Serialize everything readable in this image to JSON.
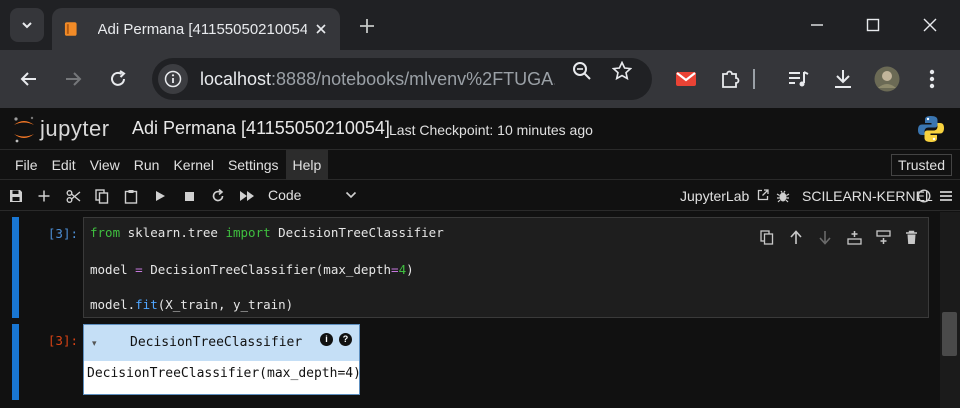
{
  "browser": {
    "tab_title": "Adi Permana [41155050210054]",
    "url_host": "localhost",
    "url_rest": ":8888/notebooks/mlvenv%2FTUGA..."
  },
  "jupyter": {
    "logo_text": "jupyter",
    "notebook_title": "Adi Permana [41155050210054]",
    "checkpoint": "Last Checkpoint: 10 minutes ago"
  },
  "menu": {
    "items": [
      "File",
      "Edit",
      "View",
      "Run",
      "Kernel",
      "Settings",
      "Help"
    ],
    "trusted": "Trusted"
  },
  "toolbar": {
    "cell_type": "Code",
    "jupyterlab_link": "JupyterLab",
    "kernel_name": "SCILEARN-KERNEL"
  },
  "cells": {
    "input_prompt": "[3]:",
    "output_prompt": "[3]:",
    "code": {
      "line1": {
        "kw1": "from",
        "mod": " sklearn.tree ",
        "kw2": "import",
        "name": " DecisionTreeClassifier"
      },
      "line2": {
        "pre": "model ",
        "eq": "=",
        "call": " DecisionTreeClassifier(max_depth",
        "eq2": "=",
        "num": "4",
        "close": ")"
      },
      "line3": {
        "pre": "model.",
        "fn": "fit",
        "args": "(X_train, y_train)"
      }
    },
    "estimator": {
      "arrow": "▾",
      "name": "DecisionTreeClassifier",
      "badge_info": "i",
      "badge_help": "?",
      "repr": "DecisionTreeClassifier(max_depth=4)"
    }
  },
  "colors": {
    "accent_blue": "#1976d2",
    "estimator_header": "#c5dff6",
    "keyword_green": "#3fbf3f",
    "output_prompt": "#d84315"
  }
}
